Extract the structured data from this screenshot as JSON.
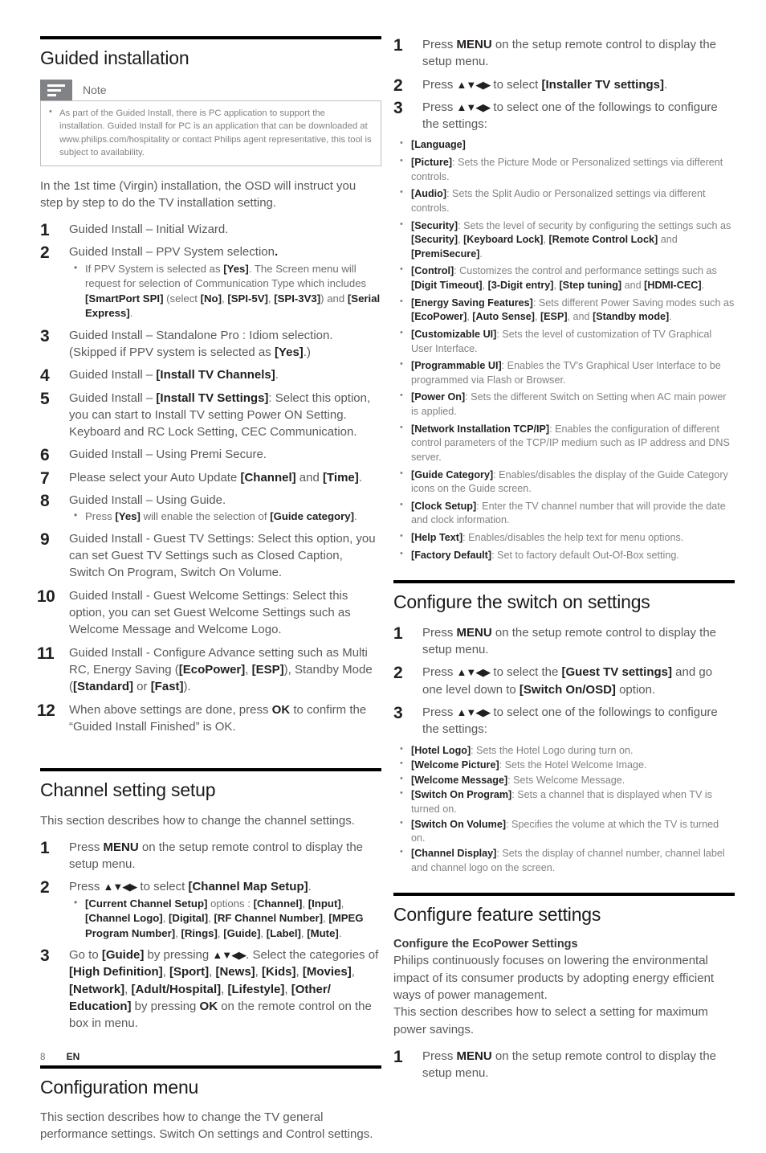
{
  "footer": {
    "page_number": "8",
    "language": "EN"
  },
  "left_column": {
    "guided_installation": {
      "title": "Guided installation",
      "note": {
        "label": "Note",
        "icon": "note-lines-icon",
        "items": [
          "As part of the Guided Install, there is PC application to support the installation. Guided Install for PC is an application that can be downloaded at www.philips.com/hospitality or contact Philips agent representative, this tool is subject to availability."
        ]
      },
      "intro": "In the 1st time (Virgin) installation, the OSD will instruct you step by step to do the TV installation setting.",
      "steps": [
        {
          "num": "1",
          "html": "Guided Install – Initial Wizard."
        },
        {
          "num": "2",
          "html": "Guided Install – PPV System selection<b>.</b>",
          "sub": [
            "If PPV System is selected as <b>[Yes]</b>. The Screen menu will request for selection of Communication Type which includes <b>[SmartPort SPI]</b> (select <b>[No]</b>, <b>[SPI-5V]</b>, <b>[SPI-3V3]</b>) and <b>[Serial Express]</b>."
          ]
        },
        {
          "num": "3",
          "html": "Guided Install – Standalone Pro : Idiom selection. (Skipped if PPV system is selected as <b>[Yes]</b>.)"
        },
        {
          "num": "4",
          "html": "Guided Install – <b>[Install TV Channels]</b>."
        },
        {
          "num": "5",
          "html": "Guided Install – <b>[Install TV Settings]</b>: Select this option, you can start to Install TV setting Power ON Setting. Keyboard and RC Lock Setting, CEC Communication."
        },
        {
          "num": "6",
          "html": "Guided Install – Using Premi Secure."
        },
        {
          "num": "7",
          "html": "Please select your Auto Update <b>[Channel]</b> and <b>[Time]</b>."
        },
        {
          "num": "8",
          "html": "Guided Install – Using Guide.",
          "sub": [
            "Press <b>[Yes]</b> will enable the selection of <b>[Guide category]</b>."
          ]
        },
        {
          "num": "9",
          "html": "Guided Install - Guest TV Settings: Select this option, you can set Guest TV Settings such as Closed Caption, Switch On Program, Switch On Volume."
        },
        {
          "num": "10",
          "html": "Guided Install - Guest Welcome Settings: Select this option, you can set Guest Welcome Settings such as Welcome Message and Welcome Logo."
        },
        {
          "num": "11",
          "html": "Guided Install - Configure Advance setting such as Multi RC, Energy Saving (<b>[EcoPower]</b>, <b>[ESP]</b>), Standby Mode (<b>[Standard]</b> or <b>[Fast]</b>)."
        },
        {
          "num": "12",
          "html": "When above settings are done, press <b>OK</b> to confirm the “Guided Install Finished” is OK."
        }
      ]
    },
    "channel_setting_setup": {
      "title": "Channel setting setup",
      "intro": "This section describes how to change the channel settings.",
      "steps": [
        {
          "num": "1",
          "html": "Press <b>MENU</b> on the setup remote control to display the setup menu."
        },
        {
          "num": "2",
          "html": "Press <span class=\"arrows\">▲▼◀▶</span> to select <b>[Channel Map Setup]</b>.",
          "sub": [
            "<b>[Current Channel Setup]</b> options : <b>[Channel]</b>, <b>[Input]</b>, <b>[Channel Logo]</b>, <b>[Digital]</b>, <b>[RF Channel Number]</b>, <b>[MPEG Program Number]</b>, <b>[Rings]</b>, <b>[Guide]</b>, <b>[Label]</b>, <b>[Mute]</b>."
          ]
        },
        {
          "num": "3",
          "html": "Go to <b>[Guide]</b> by pressing <span class=\"arrows\">▲▼◀▶</span>. Select the categories of <b>[High Definition]</b>, <b>[Sport]</b>, <b>[News]</b>, <b>[Kids]</b>, <b>[Movies]</b>, <b>[Network]</b>, <b>[Adult/Hospital]</b>, <b>[Lifestyle]</b>, <b>[Other/ Education]</b> by pressing <b>OK</b> on the remote control on the box in menu."
        }
      ]
    },
    "configuration_menu": {
      "title": "Configuration menu",
      "intro": "This section describes how to change the TV general performance settings. Switch On settings and Control settings."
    }
  },
  "right_column": {
    "configuration_steps": [
      {
        "num": "1",
        "html": "Press <b>MENU</b> on the setup remote control to display the setup menu."
      },
      {
        "num": "2",
        "html": "Press <span class=\"arrows\">▲▼◀▶</span> to select <b>[Installer TV settings]</b>."
      },
      {
        "num": "3",
        "html": "Press <span class=\"arrows\">▲▼◀▶</span> to select one of the followings to configure the settings:"
      }
    ],
    "configuration_options": [
      "<b>[Language]</b>",
      "<b>[Picture]</b>: Sets the Picture Mode or Personalized settings via different controls.",
      "<b>[Audio]</b>: Sets the Split Audio or Personalized settings via different controls.",
      "<b>[Security]</b>: Sets the level of security by configuring the settings such as <b>[Security]</b>, <b>[Keyboard Lock]</b>, <b>[Remote Control Lock]</b> and <b>[PremiSecure]</b>.",
      "<b>[Control]</b>: Customizes the control and performance settings such as <b>[Digit Timeout]</b>, <b>[3-Digit entry]</b>, <b>[Step tuning]</b> and <b>[HDMI-CEC]</b>.",
      "<b>[Energy Saving Features]</b>: Sets different Power Saving modes such as <b>[EcoPower]</b>, <b>[Auto Sense]</b>, <b>[ESP]</b>, and <b>[Standby mode]</b>.",
      "<b>[Customizable UI]</b>: Sets the level of customization of TV Graphical User Interface.",
      "<b>[Programmable UI]</b>: Enables the TV's Graphical User Interface to be programmed via Flash or Browser.",
      "<b>[Power On]</b>: Sets the different Switch on Setting when AC main power is applied.",
      "<b>[Network Installation TCP/IP]</b>: Enables the configuration of different control parameters of the TCP/IP medium such as IP address and DNS server.",
      "<b>[Guide Category]</b>: Enables/disables the display of the Guide Category icons on the Guide screen.",
      "<b>[Clock Setup]</b>: Enter the TV channel number that will provide the date and clock information.",
      "<b>[Help Text]</b>: Enables/disables the help text for menu options.",
      "<b>[Factory Default]</b>: Set to factory default Out-Of-Box setting."
    ],
    "switch_on_settings": {
      "title": "Configure the switch on settings",
      "steps": [
        {
          "num": "1",
          "html": "Press <b>MENU</b> on the setup remote control to display the setup menu."
        },
        {
          "num": "2",
          "html": "Press <span class=\"arrows\">▲▼◀▶</span> to select the <b>[Guest TV settings]</b> and go one level down to <b>[Switch On/OSD]</b> option."
        },
        {
          "num": "3",
          "html": "Press <span class=\"arrows\">▲▼◀▶</span> to select one of the followings to configure the settings:"
        }
      ],
      "options": [
        "<b>[Hotel Logo]</b>: Sets the Hotel Logo during turn on.",
        "<b>[Welcome Picture]</b>: Sets the Hotel Welcome Image.",
        "<b>[Welcome Message]</b>: Sets Welcome Message.",
        "<b>[Switch On Program]</b>: Sets a channel that is displayed when TV is turned on.",
        "<b>[Switch On Volume]</b>: Specifies the volume at which the TV is turned on.",
        "<b>[Channel Display]</b>: Sets the display of channel number, channel label and channel logo on the screen."
      ]
    },
    "feature_settings": {
      "title": "Configure feature settings",
      "subheading": "Configure the EcoPower Settings",
      "paragraph1": "Philips continuously focuses on lowering the environmental impact of its consumer products by adopting energy efficient ways of power management.",
      "paragraph2": "This section describes how to select a setting for maximum power savings.",
      "steps": [
        {
          "num": "1",
          "html": "Press <b>MENU</b> on the setup remote control to display the setup menu."
        }
      ]
    }
  }
}
